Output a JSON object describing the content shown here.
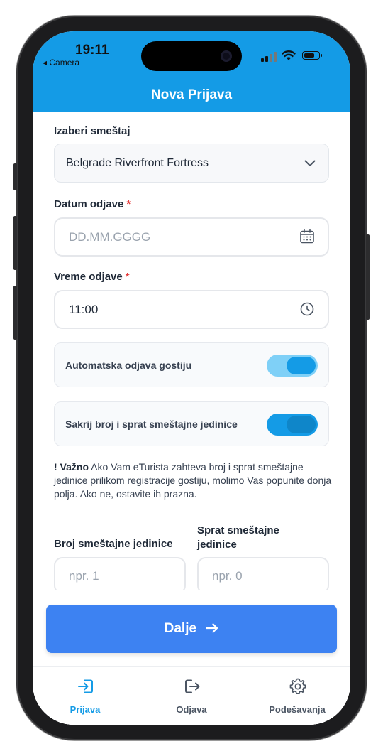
{
  "status_bar": {
    "time": "19:11",
    "back_label": "◂ Camera"
  },
  "header": {
    "title": "Nova Prijava"
  },
  "form": {
    "accommodation": {
      "label": "Izaberi smeštaj",
      "selected": "Belgrade Riverfront Fortress"
    },
    "checkout_date": {
      "label": "Datum odjave",
      "required_mark": "*",
      "placeholder": "DD.MM.GGGG"
    },
    "checkout_time": {
      "label": "Vreme odjave",
      "required_mark": "*",
      "value": "11:00"
    },
    "auto_checkout": {
      "label": "Automatska odjava gostiju",
      "enabled": true
    },
    "hide_unit": {
      "label": "Sakrij broj i sprat smeštajne jedinice",
      "enabled": true
    },
    "note": {
      "prefix": "! Važno",
      "text": " Ako Vam eTurista zahteva broj i sprat smeštajne jedinice prilikom registracije gostiju, molimo Vas popunite donja polja. Ako ne, ostavite ih prazna."
    },
    "unit_number": {
      "label": "Broj smeštajne jedinice",
      "placeholder": "npr. 1"
    },
    "unit_floor": {
      "label": "Sprat smeštajne jedinice",
      "placeholder": "npr. 0"
    }
  },
  "actions": {
    "next_label": "Dalje",
    "next_icon": "arrow-right-icon"
  },
  "tabbar": {
    "items": [
      {
        "label": "Prijava",
        "icon": "login-icon",
        "active": true
      },
      {
        "label": "Odjava",
        "icon": "logout-icon",
        "active": false
      },
      {
        "label": "Podešavanja",
        "icon": "gear-icon",
        "active": false
      }
    ]
  },
  "colors": {
    "header": "#149be6",
    "primary_button": "#3d82f2",
    "toggle_auto_track": "#7fd0f7",
    "toggle_auto_knob": "#149be6",
    "toggle_hide_track": "#149be6",
    "toggle_hide_knob": "#0f86c9",
    "tab_active": "#149be6",
    "tab_inactive": "#4b5563",
    "required": "#e53e3e"
  }
}
